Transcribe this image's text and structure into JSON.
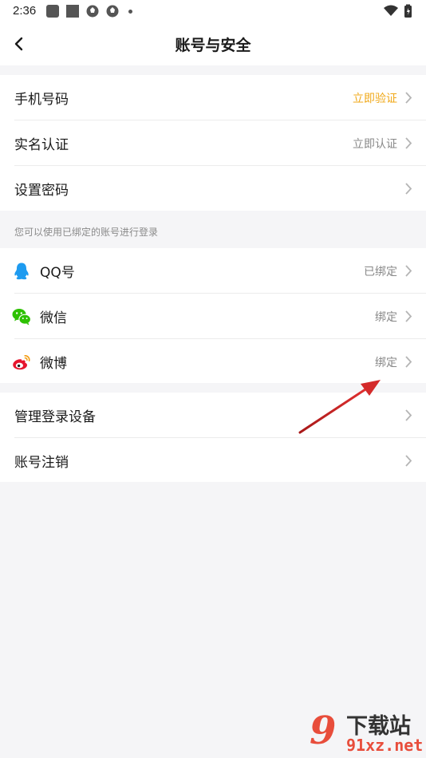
{
  "status_bar": {
    "time": "2:36"
  },
  "header": {
    "title": "账号与安全"
  },
  "security": [
    {
      "label": "手机号码",
      "value": "立即验证"
    },
    {
      "label": "实名认证",
      "value": "立即认证"
    },
    {
      "label": "设置密码",
      "value": ""
    }
  ],
  "bind_note": "您可以使用已绑定的账号进行登录",
  "bindings": [
    {
      "icon": "qq-icon",
      "label": "QQ号",
      "value": "已绑定"
    },
    {
      "icon": "wechat-icon",
      "label": "微信",
      "value": "绑定"
    },
    {
      "icon": "weibo-icon",
      "label": "微博",
      "value": "绑定"
    }
  ],
  "management": [
    {
      "label": "管理登录设备"
    },
    {
      "label": "账号注销"
    }
  ],
  "colors": {
    "accent": "#f0a818",
    "qq": "#1e9bf0",
    "wechat": "#2dc100",
    "weibo": "#e6162d",
    "annotation_arrow": "#d42a2a"
  },
  "watermark": {
    "logo": "9",
    "cn": "下载站",
    "url": "91xz.net"
  }
}
